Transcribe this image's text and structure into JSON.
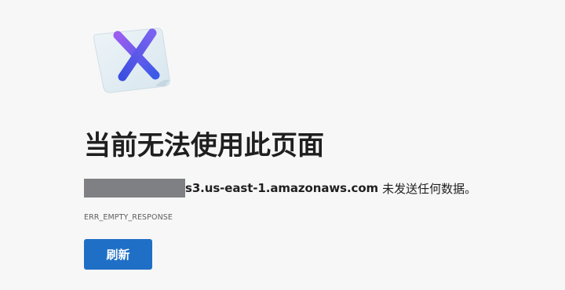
{
  "error_page": {
    "headline": "当前无法使用此页面",
    "host": "s3.us-east-1.amazonaws.com",
    "message_tail": "未发送任何数据。",
    "error_code": "ERR_EMPTY_RESPONSE",
    "reload_label": "刷新",
    "illustration_icon": "broken-page-x-icon"
  },
  "colors": {
    "page_background": "#f7f7f7",
    "button_primary": "#1f6fc6",
    "redaction_block": "#7f8083"
  }
}
